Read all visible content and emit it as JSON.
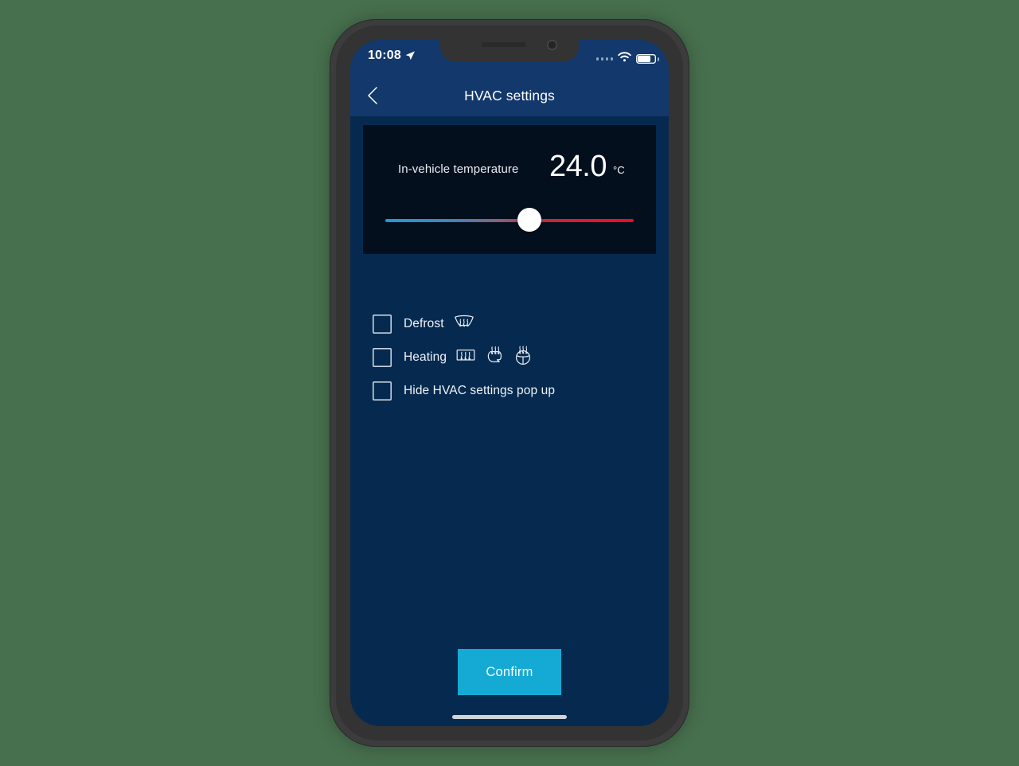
{
  "status_bar": {
    "time": "10:08",
    "location_icon": "location-arrow-icon",
    "signal_icon": "signal-dots-icon",
    "wifi_icon": "wifi-icon",
    "battery_icon": "battery-icon",
    "battery_level_pct": 75
  },
  "header": {
    "back_icon": "chevron-left-icon",
    "title": "HVAC settings"
  },
  "temperature_panel": {
    "label": "In-vehicle temperature",
    "value": "24.0",
    "unit": "°C",
    "slider": {
      "position_pct": 58,
      "cold_color": "#1E9BDC",
      "hot_color": "#E8132B",
      "thumb_color": "#FFFFFF"
    }
  },
  "options": [
    {
      "label": "Defrost",
      "checked": false,
      "icons": [
        "windshield-defrost-icon"
      ]
    },
    {
      "label": "Heating",
      "checked": false,
      "icons": [
        "rear-window-defrost-icon",
        "seat-heater-icon",
        "steering-wheel-heater-icon"
      ]
    },
    {
      "label": "Hide HVAC settings pop up",
      "checked": false,
      "icons": []
    }
  ],
  "footer": {
    "confirm_label": "Confirm"
  },
  "colors": {
    "page_background": "#47704E",
    "header_blue": "#13386B",
    "screen_background": "#062A4F",
    "panel_background": "#040F1E",
    "accent_cyan": "#14AAD4",
    "text_light": "#EEF2F7"
  }
}
